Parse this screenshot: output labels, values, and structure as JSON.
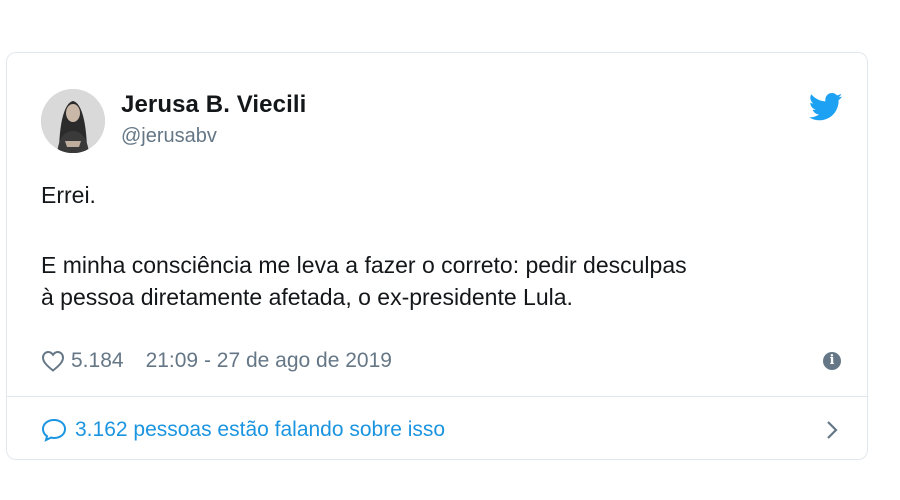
{
  "tweet": {
    "author_name": "Jerusa B. Viecili",
    "author_handle": "@jerusabv",
    "text_line1": "Errei.",
    "text_line2": "E minha consciência me leva a fazer o correto: pedir desculpas",
    "text_line3": "à pessoa diretamente afetada, o ex-presidente Lula.",
    "likes": "5.184",
    "timestamp": "21:09 - 27 de ago de 2019",
    "conversation_text": "3.162 pessoas estão falando sobre isso"
  },
  "icons": {
    "brand": "twitter-bird-icon",
    "like": "heart-icon",
    "info": "info-icon",
    "reply": "speech-bubble-icon",
    "more": "chevron-right-icon"
  },
  "colors": {
    "twitter_blue": "#1da1f2",
    "link_blue": "#1b95e0",
    "secondary_text": "#657786",
    "border": "#e1e8ed"
  }
}
